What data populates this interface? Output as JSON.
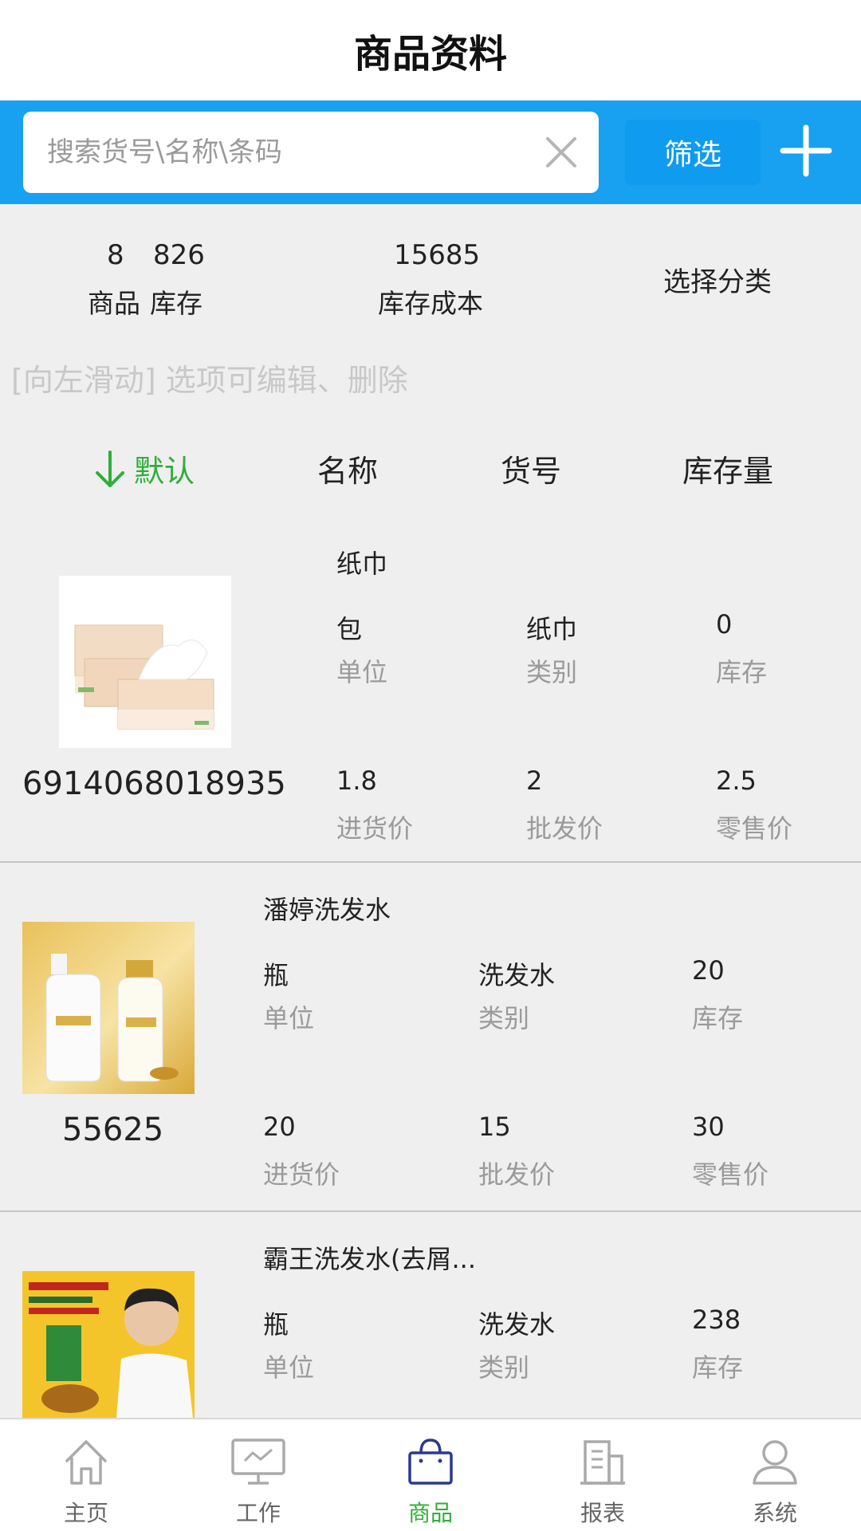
{
  "header": {
    "title": "商品资料"
  },
  "search": {
    "placeholder": "搜索货号\\名称\\条码",
    "value": "",
    "filter_label": "筛选"
  },
  "stats": {
    "product_count": "8",
    "product_label": "商品",
    "stock_count": "826",
    "stock_label": "库存",
    "stock_cost": "15685",
    "stock_cost_label": "库存成本",
    "category_label": "选择分类"
  },
  "hint": "[向左滑动] 选项可编辑、删除",
  "sort": {
    "default": "默认",
    "name": "名称",
    "code": "货号",
    "stock": "库存量"
  },
  "labels": {
    "unit": "单位",
    "category": "类别",
    "stock": "库存",
    "purchase_price": "进货价",
    "wholesale_price": "批发价",
    "retail_price": "零售价"
  },
  "products": [
    {
      "name": "纸巾",
      "code": "6914068018935",
      "unit": "包",
      "category": "纸巾",
      "stock": "0",
      "purchase_price": "1.8",
      "wholesale_price": "2",
      "retail_price": "2.5",
      "image": "tissue-box-image"
    },
    {
      "name": "潘婷洗发水",
      "code": "55625",
      "unit": "瓶",
      "category": "洗发水",
      "stock": "20",
      "purchase_price": "20",
      "wholesale_price": "15",
      "retail_price": "30",
      "image": "shampoo-bottle-image"
    },
    {
      "name": "霸王洗发水(去屑...",
      "code": "",
      "unit": "瓶",
      "category": "洗发水",
      "stock": "238",
      "image": "shampoo-ad-poster-image"
    }
  ],
  "tabs": [
    {
      "label": "主页",
      "icon": "home-icon"
    },
    {
      "label": "工作",
      "icon": "monitor-icon"
    },
    {
      "label": "商品",
      "icon": "shopping-bag-icon",
      "active": true
    },
    {
      "label": "报表",
      "icon": "report-building-icon"
    },
    {
      "label": "系统",
      "icon": "user-icon"
    }
  ],
  "colors": {
    "accent_blue": "#17a1f0",
    "active_green": "#2fae3a",
    "background": "#efefef"
  }
}
